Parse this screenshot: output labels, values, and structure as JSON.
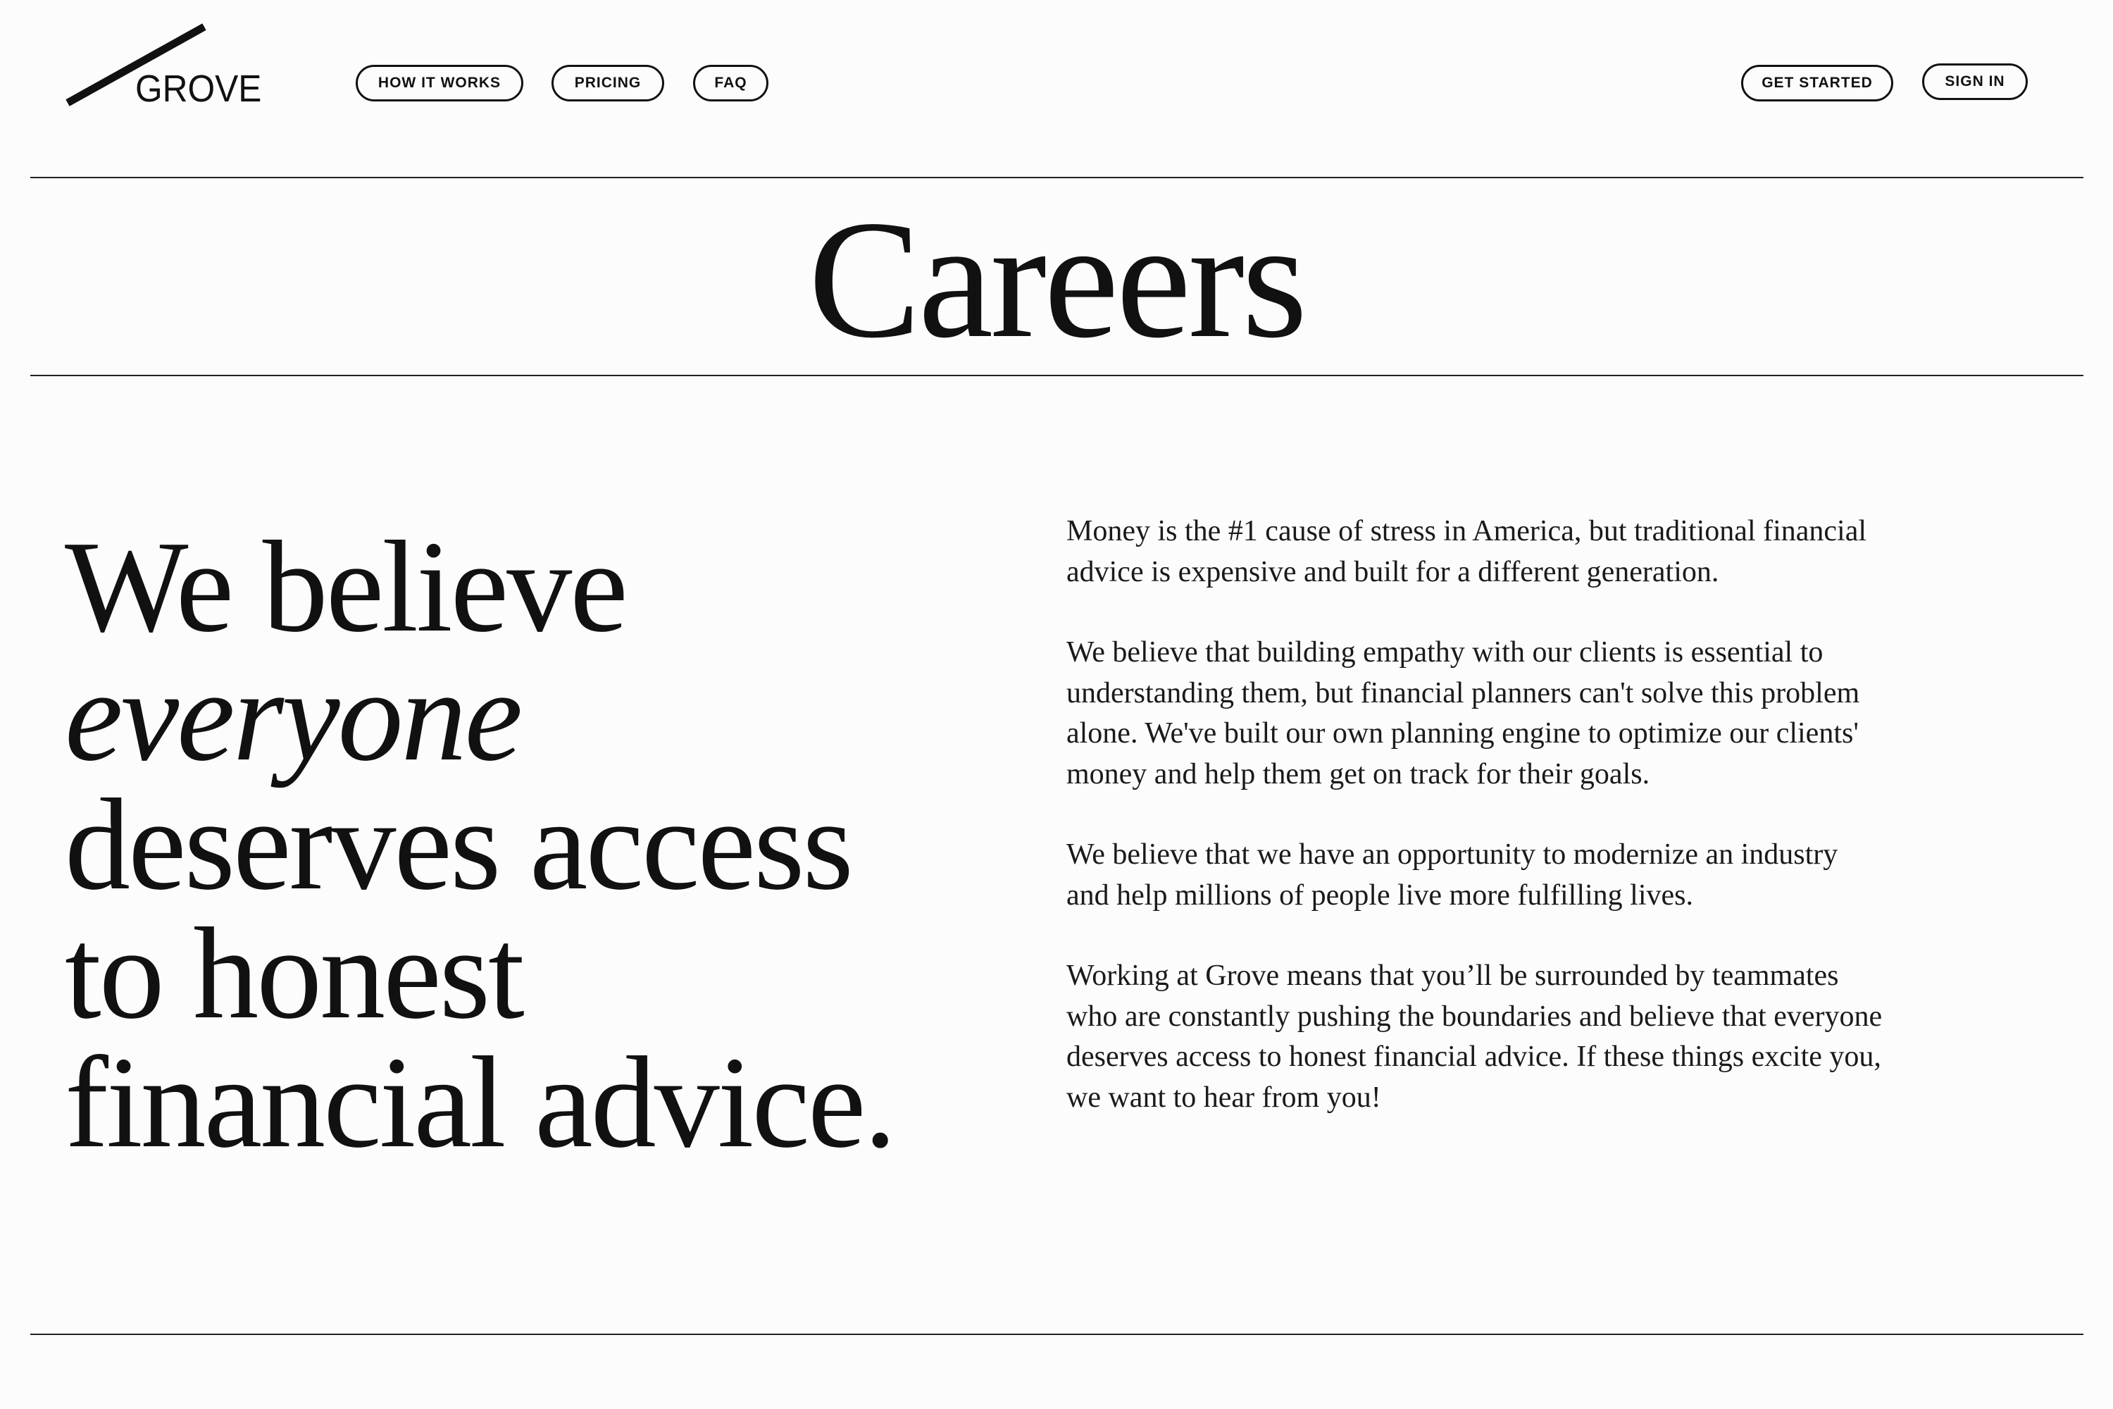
{
  "brand": {
    "name": "GROVE"
  },
  "nav": {
    "links": [
      {
        "label": "HOW IT WORKS"
      },
      {
        "label": "PRICING"
      },
      {
        "label": "FAQ"
      }
    ],
    "get_started": "GET STARTED",
    "sign_in": "SIGN IN"
  },
  "page": {
    "title": "Careers"
  },
  "hero": {
    "line1": "We believe",
    "line2": "everyone",
    "line3": "deserves access",
    "line4": "to honest",
    "line5": "financial advice."
  },
  "body": {
    "paragraphs": [
      "Money is the #1 cause of stress in America, but traditional financial advice is expensive and built for a different generation.",
      "We believe that building empathy with our clients is essential to understanding them, but financial planners can't solve this problem alone. We've built our own planning engine to optimize our clients' money and help them get on track for their goals.",
      "We believe that we have an opportunity to modernize an industry and help millions of people live more fulfilling lives.",
      "Working at Grove means that you’ll be surrounded by teammates who are constantly pushing the boundaries and believe that everyone deserves access to honest financial advice. If these things excite you, we want to hear from you!"
    ]
  },
  "colors": {
    "background": "#fcfcfc",
    "ink": "#111111"
  }
}
